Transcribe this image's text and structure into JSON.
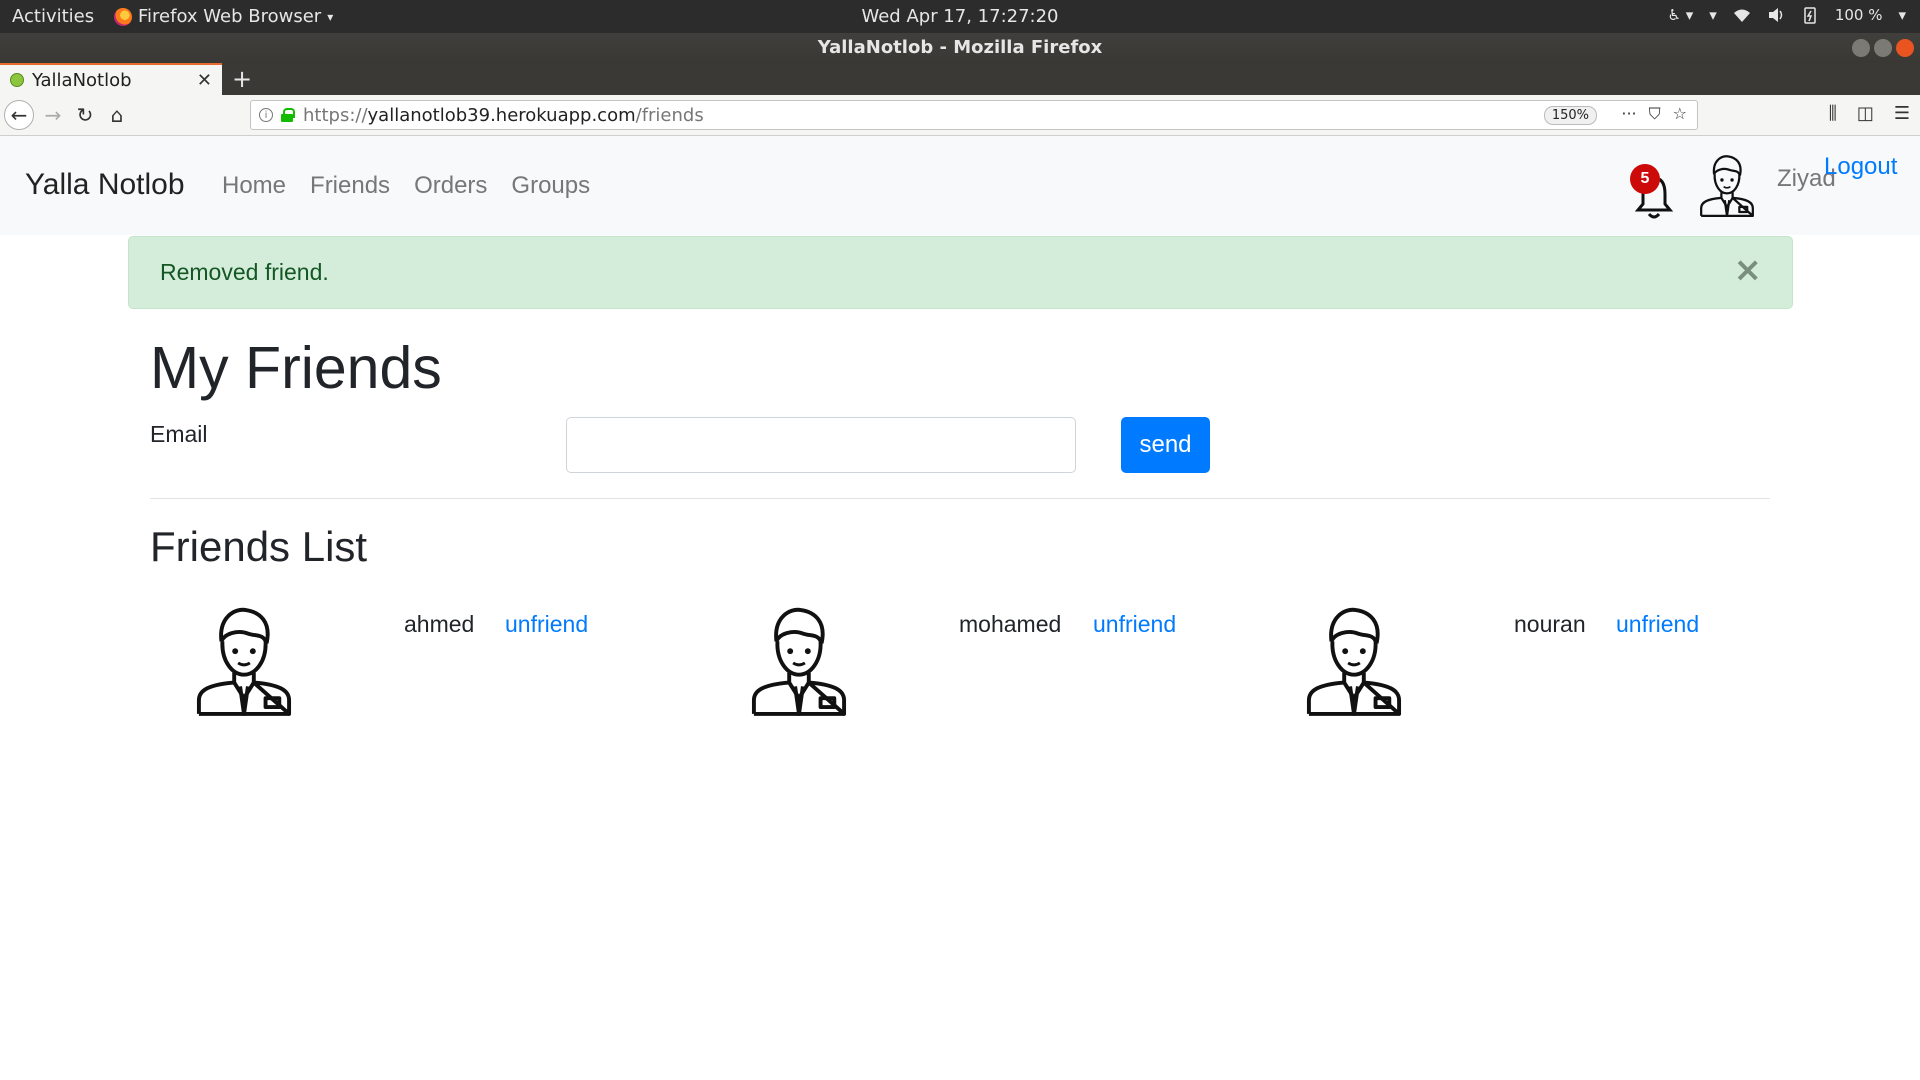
{
  "system": {
    "activities": "Activities",
    "app_menu": "Firefox Web Browser",
    "clock": "Wed Apr 17, 17:27:20",
    "battery": "100 %"
  },
  "window": {
    "title": "YallaNotlob - Mozilla Firefox"
  },
  "browser": {
    "tab_title": "YallaNotlob",
    "url_scheme": "https://",
    "url_host": "yallanotlob39.herokuapp.com",
    "url_path": "/friends",
    "zoom": "150%"
  },
  "site": {
    "brand": "Yalla Notlob",
    "nav": [
      "Home",
      "Friends",
      "Orders",
      "Groups"
    ],
    "notification_count": "5",
    "username": "Ziyad",
    "logout": "Logout"
  },
  "alert": {
    "message": "Removed friend.",
    "close": "×"
  },
  "main": {
    "title": "My Friends",
    "email_label": "Email",
    "email_value": "",
    "send_label": "send",
    "list_title": "Friends List",
    "friends": [
      {
        "name": "ahmed",
        "action": "unfriend"
      },
      {
        "name": "mohamed",
        "action": "unfriend"
      },
      {
        "name": "nouran",
        "action": "unfriend"
      }
    ]
  },
  "colors": {
    "primary": "#007bff",
    "alert_bg": "#d4edda",
    "alert_text": "#155724",
    "badge": "#cc0a0a"
  }
}
